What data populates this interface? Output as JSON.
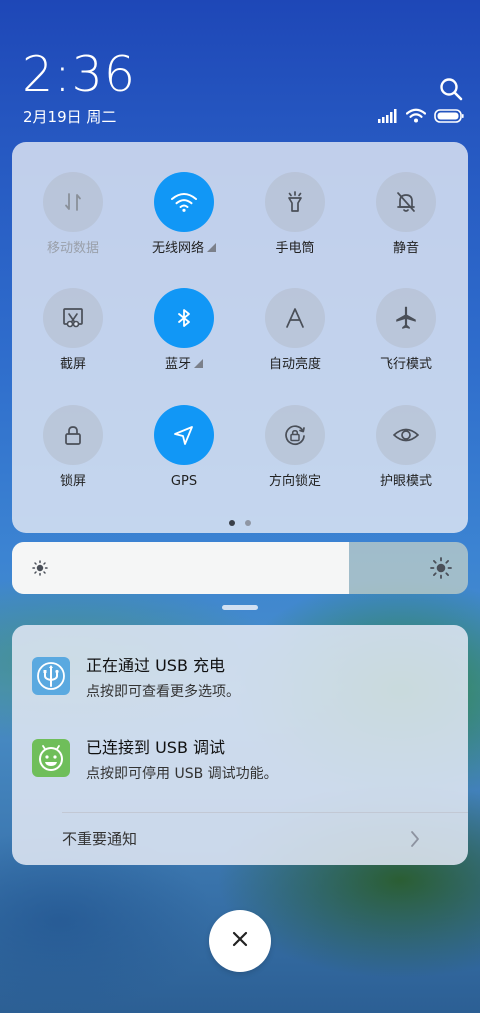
{
  "header": {
    "time": "2:36",
    "date": "2月19日 周二"
  },
  "quick_settings": {
    "tiles": [
      {
        "label": "移动数据",
        "icon": "data-arrows-icon",
        "active": false,
        "disabled": true
      },
      {
        "label": "无线网络",
        "icon": "wifi-icon",
        "active": true,
        "has_menu": true
      },
      {
        "label": "手电筒",
        "icon": "flashlight-icon",
        "active": false
      },
      {
        "label": "静音",
        "icon": "bell-off-icon",
        "active": false
      },
      {
        "label": "截屏",
        "icon": "screenshot-icon",
        "active": false
      },
      {
        "label": "蓝牙",
        "icon": "bluetooth-icon",
        "active": true,
        "has_menu": true
      },
      {
        "label": "自动亮度",
        "icon": "auto-brightness-icon",
        "active": false
      },
      {
        "label": "飞行模式",
        "icon": "airplane-icon",
        "active": false
      },
      {
        "label": "锁屏",
        "icon": "lock-icon",
        "active": false
      },
      {
        "label": "GPS",
        "icon": "location-arrow-icon",
        "active": true
      },
      {
        "label": "方向锁定",
        "icon": "rotation-lock-icon",
        "active": false
      },
      {
        "label": "护眼模式",
        "icon": "eye-icon",
        "active": false
      }
    ],
    "page_count": 2,
    "current_page": 1
  },
  "brightness": {
    "level": 0.74
  },
  "notifications": [
    {
      "title": "正在通过 USB 充电",
      "subtitle": "点按即可查看更多选项。",
      "icon": "usb-icon",
      "icon_color": "#5aa9e0"
    },
    {
      "title": "已连接到 USB 调试",
      "subtitle": "点按即可停用 USB 调试功能。",
      "icon": "android-robot-icon",
      "icon_color": "#6fbe5a"
    }
  ],
  "minor_notifications_label": "不重要通知",
  "colors": {
    "accent": "#1197f6"
  }
}
